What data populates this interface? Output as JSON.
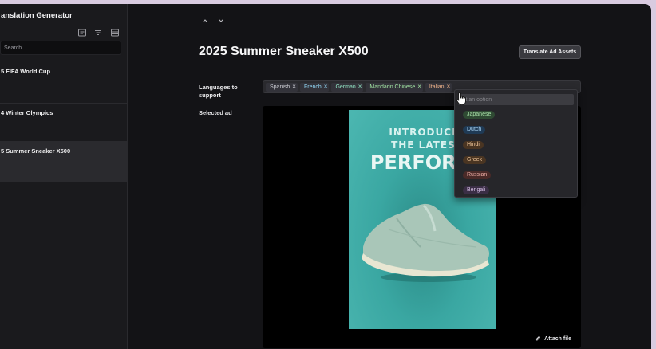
{
  "sidebar": {
    "title": "anslation Generator",
    "search_placeholder": "Search...",
    "items": [
      {
        "label": "5 FIFA World Cup"
      },
      {
        "label": "4 Winter Olympics"
      },
      {
        "label": "5 Summer Sneaker X500",
        "active": true
      }
    ]
  },
  "header": {
    "title": "2025 Summer Sneaker X500",
    "translate_button": "Translate Ad Assets"
  },
  "languages": {
    "label": "Languages to support",
    "selected": [
      {
        "name": "Spanish",
        "color": "#cfd0d6"
      },
      {
        "name": "French",
        "color": "#8fd3f0"
      },
      {
        "name": "German",
        "color": "#8fe0c0"
      },
      {
        "name": "Mandarin Chinese",
        "color": "#9fe0a0"
      },
      {
        "name": "Italian",
        "color": "#f0b48a"
      }
    ],
    "dropdown": {
      "placeholder": "ct an option",
      "options": [
        {
          "name": "Japanese",
          "color": "#a8e0a8",
          "bg": "#2f4a33"
        },
        {
          "name": "Dutch",
          "color": "#a9d4f5",
          "bg": "#1f3a55"
        },
        {
          "name": "Hindi",
          "color": "#f0c69a",
          "bg": "#4a3522"
        },
        {
          "name": "Greek",
          "color": "#f0c69a",
          "bg": "#4a3522"
        },
        {
          "name": "Russian",
          "color": "#f0b0a8",
          "bg": "#4a2a28"
        },
        {
          "name": "Bengali",
          "color": "#d8c0e8",
          "bg": "#3a2e45"
        }
      ]
    }
  },
  "ad": {
    "label": "Selected ad",
    "line1": "INTRODUCIN",
    "line2": "THE LATEST",
    "line3": "PERFORMA",
    "attach_label": "Attach file"
  },
  "colors": {
    "background": "#131316",
    "sidebar": "#1a1a1d",
    "ad_teal": "#3aa7a2"
  }
}
